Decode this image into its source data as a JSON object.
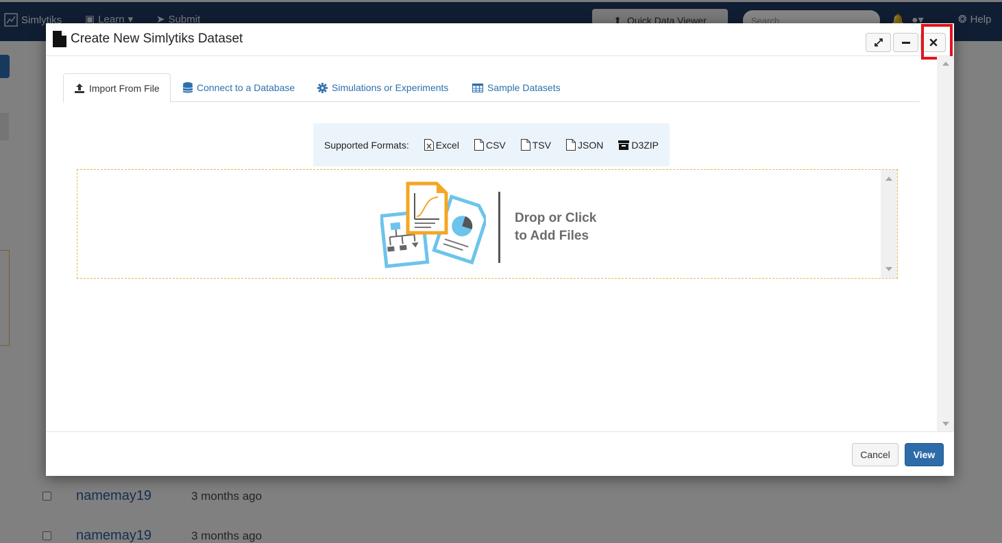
{
  "background_app": {
    "brand": "Simlytiks",
    "nav": {
      "learn_label": "Learn",
      "submit_label": "Submit",
      "quick_viewer_label": "Quick Data Viewer",
      "search_placeholder": "Search",
      "help_label": "Help"
    },
    "rows": [
      {
        "name": "namemay19",
        "when": "3 months ago"
      },
      {
        "name": "namemay19",
        "when": "3 months ago"
      }
    ]
  },
  "modal": {
    "title": "Create New Simlytiks Dataset",
    "tabs": [
      {
        "label": "Import From File",
        "icon": "upload-icon",
        "active": true
      },
      {
        "label": "Connect to a Database",
        "icon": "database-icon",
        "active": false
      },
      {
        "label": "Simulations or Experiments",
        "icon": "gear-icon",
        "active": false
      },
      {
        "label": "Sample Datasets",
        "icon": "table-icon",
        "active": false
      }
    ],
    "formats": {
      "label": "Supported Formats:",
      "items": [
        "Excel",
        "CSV",
        "TSV",
        "JSON",
        "D3ZIP"
      ]
    },
    "dropzone": {
      "line1": "Drop or Click",
      "line2": "to Add Files"
    },
    "footer": {
      "cancel_label": "Cancel",
      "view_label": "View"
    }
  },
  "colors": {
    "accent": "#2c6fae",
    "primary_button": "#2d6ca8",
    "highlight": "#e0141e",
    "dropzone_border": "#e7b64b",
    "navbar": "#1f3a63"
  }
}
